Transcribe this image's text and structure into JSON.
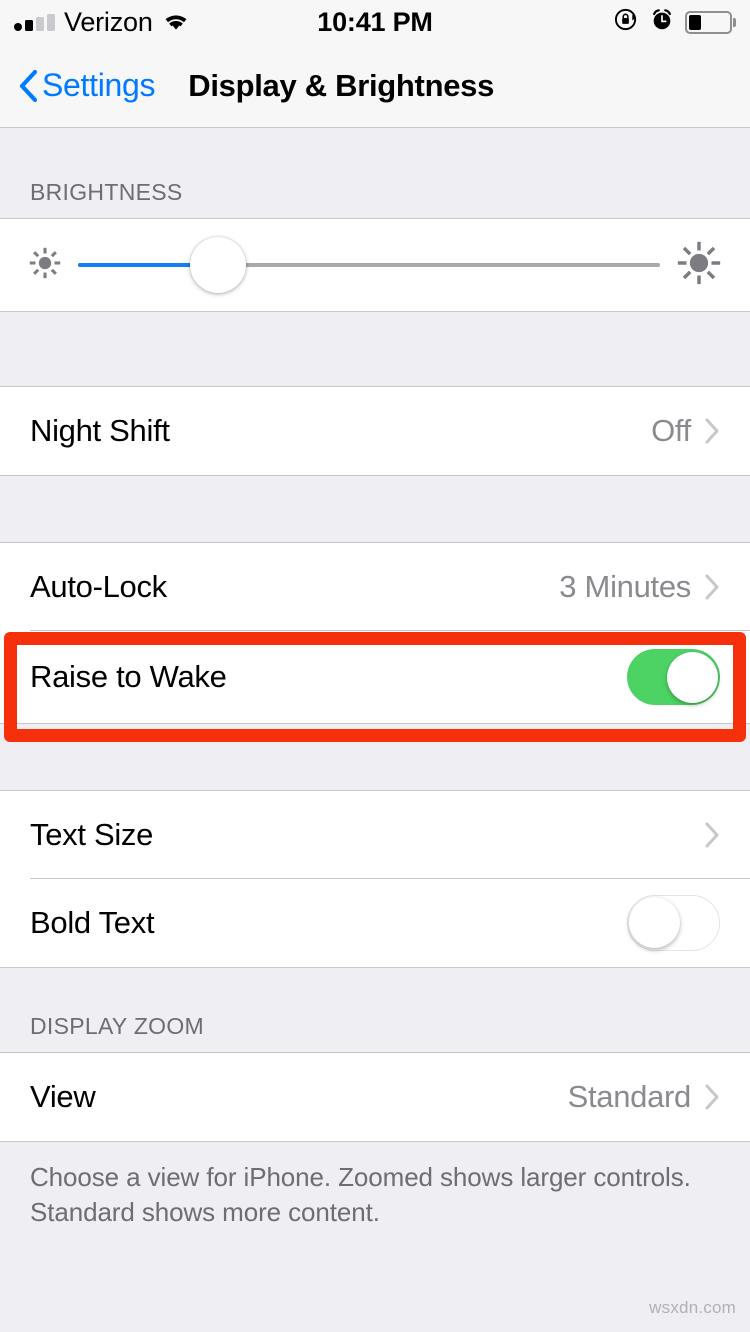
{
  "status_bar": {
    "carrier": "Verizon",
    "time": "10:41 PM",
    "signal_bars_total": 4,
    "signal_bars_filled": 2,
    "wifi": "wifi-icon",
    "rotation_lock": "rotation-lock-icon",
    "alarm": "alarm-clock-icon",
    "battery_percent": 33
  },
  "nav": {
    "back_label": "Settings",
    "title": "Display & Brightness"
  },
  "brightness": {
    "header": "BRIGHTNESS",
    "value_percent": 24,
    "icon_low": "sun-small-icon",
    "icon_high": "sun-large-icon"
  },
  "night_shift": {
    "label": "Night Shift",
    "value": "Off"
  },
  "lock_group": {
    "auto_lock": {
      "label": "Auto-Lock",
      "value": "3 Minutes"
    },
    "raise_to_wake": {
      "label": "Raise to Wake",
      "state": "on"
    }
  },
  "text_group": {
    "text_size": {
      "label": "Text Size"
    },
    "bold_text": {
      "label": "Bold Text",
      "state": "off"
    }
  },
  "display_zoom": {
    "header": "DISPLAY ZOOM",
    "view": {
      "label": "View",
      "value": "Standard"
    },
    "footer": "Choose a view for iPhone. Zoomed shows larger controls. Standard shows more content."
  },
  "annotation": {
    "color": "#F5300A",
    "target": "Raise to Wake"
  },
  "watermark": "wsxdn.com"
}
